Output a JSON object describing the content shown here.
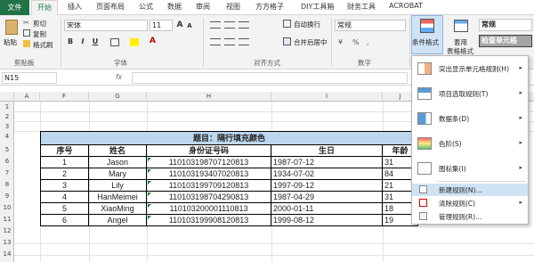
{
  "tabs": [
    "文件",
    "开始",
    "插入",
    "页面布局",
    "公式",
    "数据",
    "审阅",
    "视图",
    "方方格子",
    "DIY工具箱",
    "财务工具",
    "ACROBAT"
  ],
  "clipboard": {
    "paste": "粘贴",
    "cut": "剪切",
    "copy": "复制",
    "format_painter": "格式刷",
    "label": "剪贴板"
  },
  "font": {
    "name": "宋体",
    "size": "11",
    "label": "字体",
    "bold": "B",
    "italic": "I",
    "underline": "U",
    "grow": "A",
    "shrink": "A"
  },
  "alignment": {
    "wrap": "自动换行",
    "merge": "合并后居中",
    "label": "对齐方式"
  },
  "number": {
    "format": "常规",
    "label": "数字"
  },
  "styles": {
    "conditional": "条件格式",
    "table": "套用",
    "table2": "表格格式",
    "normal": "常规",
    "check": "检查单元格"
  },
  "formula_bar": {
    "name_box": "N15",
    "fx": "fx",
    "content": ""
  },
  "columns": [
    "A",
    "F",
    "G",
    "H",
    "I",
    "J"
  ],
  "rows": [
    "1",
    "2",
    "3",
    "4",
    "5",
    "6",
    "7",
    "8",
    "9",
    "10",
    "11",
    "12",
    "13",
    "14"
  ],
  "table": {
    "title": "题目：隔行填充颜色",
    "headers": [
      "序号",
      "姓名",
      "身份证号码",
      "生日",
      "年龄"
    ],
    "rows": [
      [
        "1",
        "Jason",
        "110103198707120813",
        "1987-07-12",
        "31"
      ],
      [
        "2",
        "Mary",
        "110103193407020813",
        "1934-07-02",
        "84"
      ],
      [
        "3",
        "Lily",
        "110103199709120813",
        "1997-09-12",
        "21"
      ],
      [
        "4",
        "HanMeimei",
        "110103198704290813",
        "1987-04-29",
        "31"
      ],
      [
        "5",
        "XiaoMing",
        "110103200001110813",
        "2000-01-11",
        "18"
      ],
      [
        "6",
        "Angel",
        "110103199908120813",
        "1999-08-12",
        "19"
      ]
    ]
  },
  "menu": {
    "items": [
      {
        "label": "突出显示单元格规则(H)",
        "arrow": "▸"
      },
      {
        "label": "项目选取规则(T)",
        "arrow": "▸"
      },
      {
        "label": "数据条(D)",
        "arrow": "▸"
      },
      {
        "label": "色阶(S)",
        "arrow": "▸"
      },
      {
        "label": "图标集(I)",
        "arrow": "▸"
      }
    ],
    "actions": [
      {
        "label": "新建规则(N)..."
      },
      {
        "label": "清除规则(C)",
        "arrow": "▸"
      },
      {
        "label": "管理规则(R)..."
      }
    ]
  },
  "colors": {
    "accent": "#217346",
    "title_fill": "#bdd7ee",
    "highlight": "#cfe3f5"
  }
}
